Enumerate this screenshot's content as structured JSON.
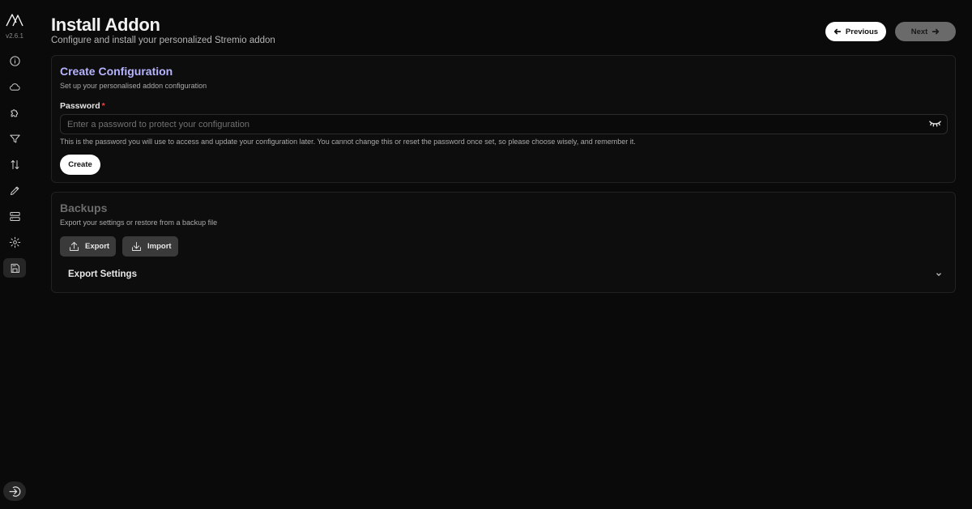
{
  "app": {
    "version": "v2.6.1",
    "logo_icon": "mountain-logo-icon"
  },
  "sidebar": {
    "items": [
      {
        "name": "about",
        "icon": "info-icon",
        "active": false
      },
      {
        "name": "services",
        "icon": "cloud-icon",
        "active": false
      },
      {
        "name": "addons",
        "icon": "puzzle-icon",
        "active": false
      },
      {
        "name": "filters",
        "icon": "filter-icon",
        "active": false
      },
      {
        "name": "sorting",
        "icon": "sort-icon",
        "active": false
      },
      {
        "name": "formatter",
        "icon": "pen-icon",
        "active": false
      },
      {
        "name": "proxy",
        "icon": "server-icon",
        "active": false
      },
      {
        "name": "miscellaneous",
        "icon": "gear-icon",
        "active": false
      },
      {
        "name": "save-install",
        "icon": "save-icon",
        "active": true
      }
    ],
    "logout_icon": "logout-icon"
  },
  "header": {
    "title": "Install Addon",
    "subtitle": "Configure and install your personalized Stremio addon",
    "previous_label": "Previous",
    "next_label": "Next"
  },
  "config": {
    "title": "Create Configuration",
    "description": "Set up your personalised addon configuration",
    "password_label": "Password",
    "required_mark": "*",
    "password_placeholder": "Enter a password to protect your configuration",
    "password_value": "",
    "help_text": "This is the password you will use to access and update your configuration later. You cannot change this or reset the password once set, so please choose wisely, and remember it.",
    "create_label": "Create"
  },
  "backups": {
    "title": "Backups",
    "description": "Export your settings or restore from a backup file",
    "export_label": "Export",
    "import_label": "Import",
    "export_settings_label": "Export Settings"
  },
  "colors": {
    "background": "#0a0a0a",
    "accent": "#b7b4ff",
    "required": "#ef4444"
  }
}
